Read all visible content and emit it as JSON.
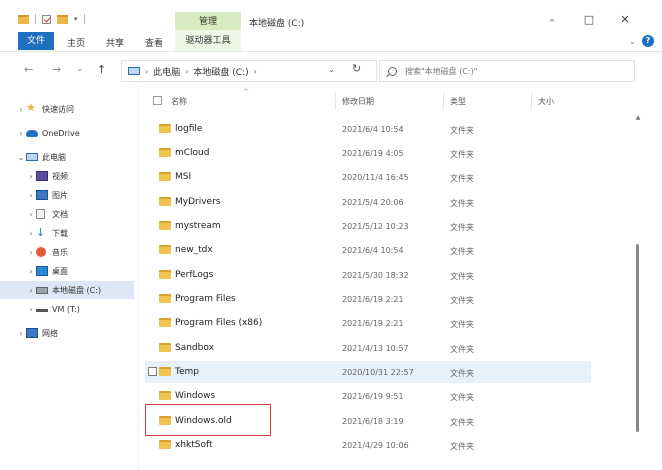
{
  "window": {
    "title": "本地磁盘 (C:)",
    "manage_tab": "管理",
    "minimize": "–",
    "maximize": "□",
    "close": "✕"
  },
  "ribbon": {
    "tabs": [
      "文件",
      "主页",
      "共享",
      "查看"
    ],
    "tools_tab": "驱动器工具",
    "help": "?"
  },
  "address": {
    "back": "←",
    "forward": "→",
    "recent": "⌄",
    "up": "↑",
    "crumbs": [
      "此电脑",
      "本地磁盘 (C:)"
    ],
    "separator": "›",
    "refresh": "↻",
    "dropdown": "⌄"
  },
  "search": {
    "placeholder": "搜索\"本地磁盘 (C:)\""
  },
  "navpane": {
    "items": [
      {
        "label": "快速访问",
        "expander": "›",
        "icon": "star-icon"
      },
      {
        "label": "OneDrive",
        "expander": "›",
        "icon": "cloud-icon"
      },
      {
        "label": "此电脑",
        "expander": "⌄",
        "icon": "computer-icon"
      },
      {
        "label": "视频",
        "expander": "›",
        "icon": "video-folder-icon"
      },
      {
        "label": "图片",
        "expander": "›",
        "icon": "pictures-folder-icon"
      },
      {
        "label": "文档",
        "expander": "›",
        "icon": "documents-folder-icon"
      },
      {
        "label": "下载",
        "expander": "›",
        "icon": "download-arrow-icon"
      },
      {
        "label": "音乐",
        "expander": "›",
        "icon": "music-icon"
      },
      {
        "label": "桌面",
        "expander": "›",
        "icon": "desktop-folder-icon"
      },
      {
        "label": "本地磁盘 (C:)",
        "expander": "›",
        "icon": "drive-icon"
      },
      {
        "label": "VM (T:)",
        "expander": "›",
        "icon": "network-drive-icon"
      },
      {
        "label": "网络",
        "expander": "›",
        "icon": "network-icon"
      }
    ]
  },
  "columns": {
    "name": "名称",
    "modified": "修改日期",
    "type": "类型",
    "size": "大小",
    "sort_caret": "^"
  },
  "files": [
    {
      "name": "logfile",
      "modified": "2021/6/4 10:54",
      "type": "文件夹"
    },
    {
      "name": "mCloud",
      "modified": "2021/6/19 4:05",
      "type": "文件夹"
    },
    {
      "name": "MSI",
      "modified": "2020/11/4 16:45",
      "type": "文件夹"
    },
    {
      "name": "MyDrivers",
      "modified": "2021/5/4 20:06",
      "type": "文件夹"
    },
    {
      "name": "mystream",
      "modified": "2021/5/12 10:23",
      "type": "文件夹"
    },
    {
      "name": "new_tdx",
      "modified": "2021/6/4 10:54",
      "type": "文件夹"
    },
    {
      "name": "PerfLogs",
      "modified": "2021/5/30 18:32",
      "type": "文件夹"
    },
    {
      "name": "Program Files",
      "modified": "2021/6/19 2:21",
      "type": "文件夹"
    },
    {
      "name": "Program Files (x86)",
      "modified": "2021/6/19 2:21",
      "type": "文件夹"
    },
    {
      "name": "Sandbox",
      "modified": "2021/4/13 10:57",
      "type": "文件夹"
    },
    {
      "name": "Temp",
      "modified": "2020/10/31 22:57",
      "type": "文件夹"
    },
    {
      "name": "Windows",
      "modified": "2021/6/19 9:51",
      "type": "文件夹"
    },
    {
      "name": "Windows.old",
      "modified": "2021/6/18 3:19",
      "type": "文件夹"
    },
    {
      "name": "xhktSoft",
      "modified": "2021/4/29 10:06",
      "type": "文件夹"
    }
  ],
  "colors": {
    "accent": "#1f6fbf",
    "manage_tab_bg": "#d8ecc2",
    "highlight": "#d93a3a",
    "hover_row": "#e5f1fb",
    "folder": "#f0c454"
  }
}
